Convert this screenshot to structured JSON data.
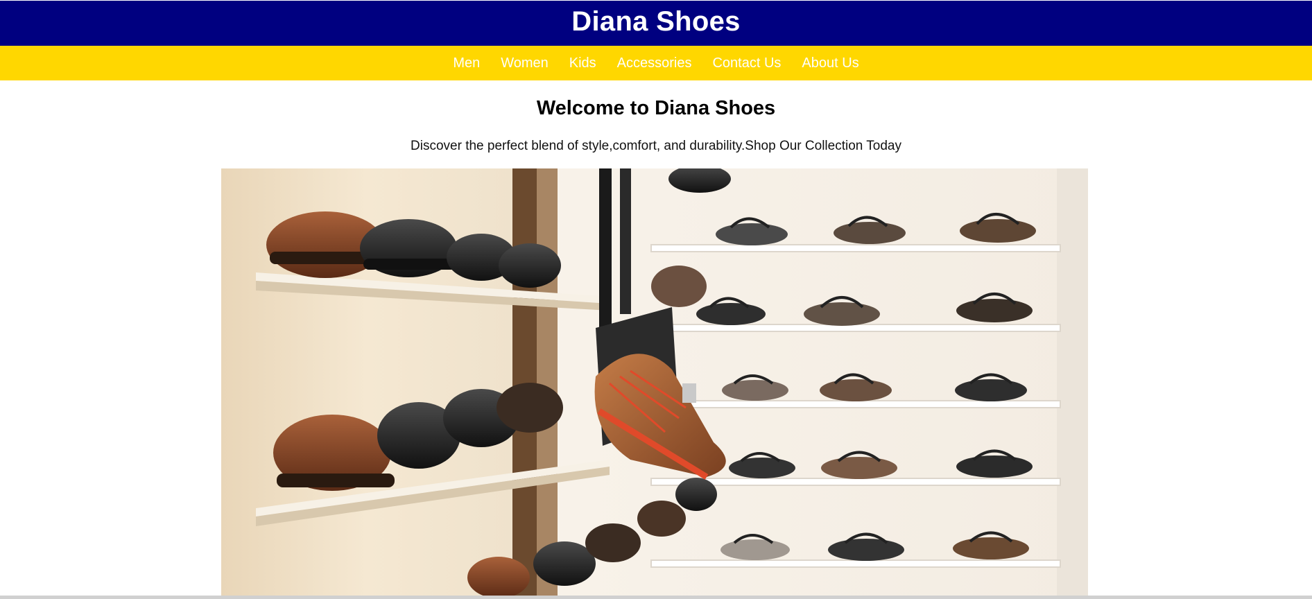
{
  "header": {
    "title": "Diana Shoes",
    "bg_color": "#000080"
  },
  "nav": {
    "bg_color": "#ffd700",
    "items": [
      {
        "label": "Men"
      },
      {
        "label": "Women"
      },
      {
        "label": "Kids"
      },
      {
        "label": "Accessories"
      },
      {
        "label": "Contact Us"
      },
      {
        "label": "About Us"
      }
    ]
  },
  "main": {
    "heading": "Welcome to Diana Shoes",
    "tagline": "Discover the perfect blend of style,comfort, and durability.Shop Our Collection Today"
  },
  "hero_image": {
    "subject": "shoe store wall with dress shoes, sneakers and sandals on shelves"
  }
}
